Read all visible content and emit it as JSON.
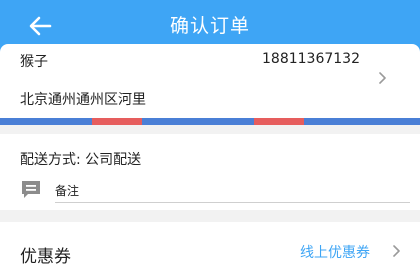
{
  "header": {
    "title": "确认订单",
    "background_color": "#3ea5f5",
    "back_icon": "arrow-left-icon"
  },
  "address": {
    "name": "猴子",
    "phone": "18811367132",
    "detail": "北京通州通州区河里",
    "chevron_icon": "chevron-right-icon",
    "stripe_colors": [
      "#4a7fd6",
      "#e65d5d"
    ]
  },
  "delivery": {
    "method_text": "配送方式: 公司配送",
    "note_label": "备注",
    "note_icon": "comment-icon"
  },
  "coupon": {
    "title": "优惠券",
    "value": "线上优惠券",
    "value_color": "#3ea5f5",
    "chevron_icon": "chevron-right-icon"
  }
}
